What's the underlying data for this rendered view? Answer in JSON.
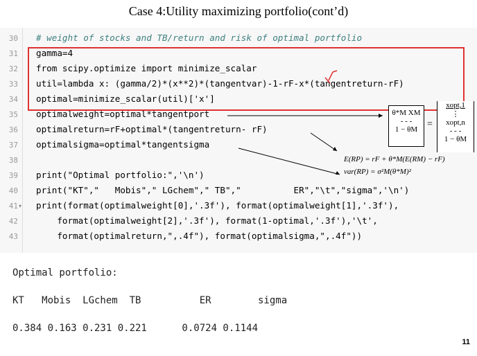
{
  "title": "Case 4:Utility maximizing portfolio(cont’d)",
  "editor": {
    "line_numbers": [
      "30",
      "31",
      "32",
      "33",
      "34",
      "35",
      "36",
      "37",
      "38",
      "39",
      "40",
      "41",
      "42",
      "43"
    ],
    "lines": [
      {
        "n": "30",
        "text": "# weight of stocks and TB/return and risk of optimal portfolio"
      },
      {
        "n": "31",
        "text": "gamma=4"
      },
      {
        "n": "32",
        "text": "from scipy.optimize import minimize_scalar"
      },
      {
        "n": "33",
        "text": "util=lambda x: (gamma/2)*(x**2)*(tangentvar)-1-rF-x*(tangentreturn-rF)"
      },
      {
        "n": "34",
        "text": "optimal=minimize_scalar(util)['x']"
      },
      {
        "n": "35",
        "text": "optimalweight=optimal*tangentport"
      },
      {
        "n": "36",
        "text": "optimalreturn=rF+optimal*(tangentreturn- rF)"
      },
      {
        "n": "37",
        "text": "optimalsigma=optimal*tangentsigma"
      },
      {
        "n": "38",
        "text": ""
      },
      {
        "n": "39",
        "text": "print(\"Optimal portfolio:\",'\\n')"
      },
      {
        "n": "40",
        "text": "print(\"KT\",\"   Mobis\",\" LGchem\",\" TB\",\"          ER\",\"\\t\",\"sigma\",'\\n')"
      },
      {
        "n": "41",
        "text": "print(format(optimalweight[0],'.3f'), format(optimalweight[1],'.3f'),"
      },
      {
        "n": "42",
        "text": "    format(optimalweight[2],'.3f'), format(1-optimal,'.3f'),'\\t',"
      },
      {
        "n": "43",
        "text": "    format(optimalreturn,\",.4f\"), format(optimalsigma,\",.4f\"))"
      }
    ]
  },
  "annotations": {
    "matrix_left_top": "θ*M XM",
    "matrix_left_dash": "- - -",
    "matrix_left_bottom": "1 − θM",
    "equals": "=",
    "matrix_right_top": "xopt,1",
    "matrix_right_dots": "⋮",
    "matrix_right_mid": "xopt,n",
    "matrix_right_dash": "- - -",
    "matrix_right_bottom": "1 − θM",
    "eq1": "E(RP) = rF + θ*M(E(RM) − rF)",
    "eq2": "var(RP) = σ²M(θ*M)²"
  },
  "output": {
    "line1": "Optimal portfolio:",
    "line2": "KT   Mobis  LGchem  TB          ER        sigma",
    "line3": "0.384 0.163 0.231 0.221      0.0724 0.1144"
  },
  "page_number": "11",
  "colors": {
    "redbox": "#e03030",
    "comment": "#408080",
    "keyword": "#008000",
    "string": "#ba2121"
  }
}
